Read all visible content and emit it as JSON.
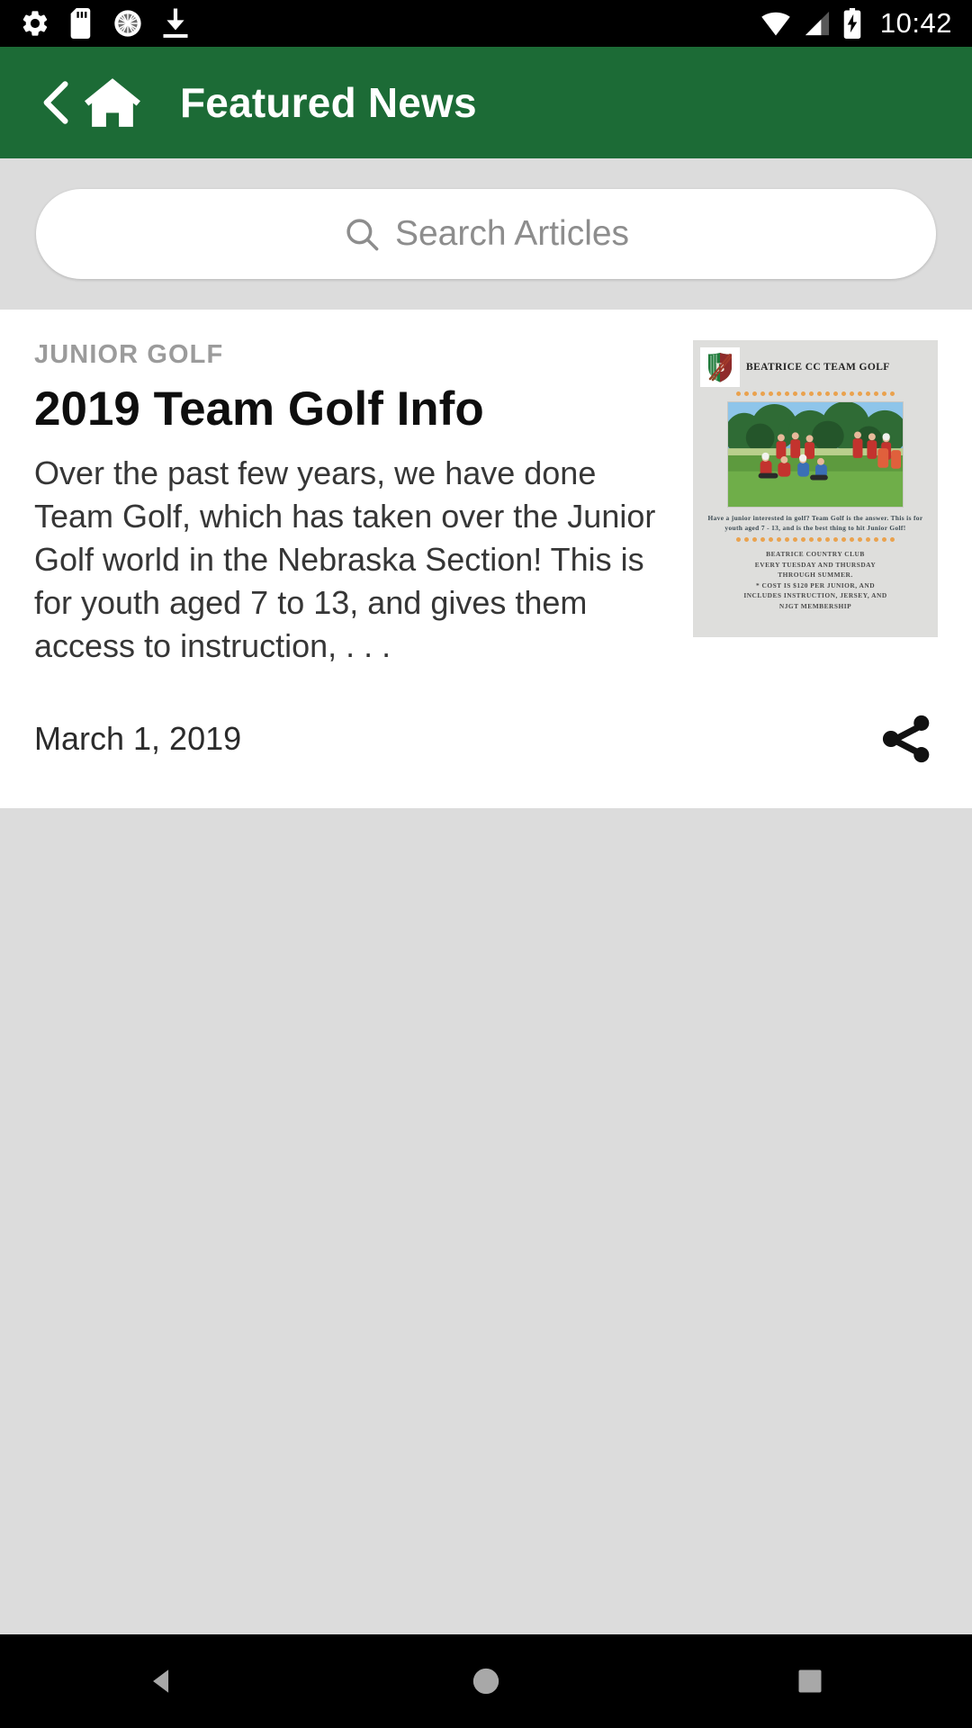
{
  "status_bar": {
    "time": "10:42",
    "left_icons": [
      "settings-gear-icon",
      "sd-card-icon",
      "sync-circle-icon",
      "download-icon"
    ],
    "right_icons": [
      "wifi-icon",
      "cellular-signal-icon",
      "battery-charging-icon"
    ]
  },
  "app_bar": {
    "title": "Featured News",
    "back_icon": "chevron-left-icon",
    "home_icon": "home-icon",
    "background_color": "#1c6b36"
  },
  "search": {
    "placeholder": "Search Articles",
    "value": "",
    "icon": "search-icon"
  },
  "article": {
    "category": "JUNIOR GOLF",
    "title": "2019 Team Golf Info",
    "excerpt": "Over the past few years, we have done Team Golf, which has taken over the Junior Golf world in the Nebraska Section! This is for youth aged 7 to 13, and gives them access to instruction, . . .",
    "date": "March 1, 2019",
    "share_icon": "share-icon",
    "thumbnail": {
      "header_title": "BEATRICE CC TEAM GOLF",
      "logo": "beatrice-country-club-crest-icon",
      "photo_alt": "junior-golf-team-group-photo",
      "caption": "Have a junior interested in golf? Team Golf is the answer. This is for youth aged 7 - 13, and is the best thing to hit Junior Golf!",
      "footer_lines": [
        "BEATRICE COUNTRY CLUB",
        "EVERY TUESDAY AND THURSDAY",
        "THROUGH SUMMER.",
        "* COST IS $120 PER JUNIOR, AND",
        "INCLUDES INSTRUCTION, JERSEY, AND",
        "NJGT MEMBERSHIP"
      ],
      "accent_color": "#eaa24e"
    }
  },
  "nav_bar": {
    "back_icon": "triangle-back-icon",
    "home_icon": "circle-home-icon",
    "recents_icon": "square-recents-icon"
  }
}
